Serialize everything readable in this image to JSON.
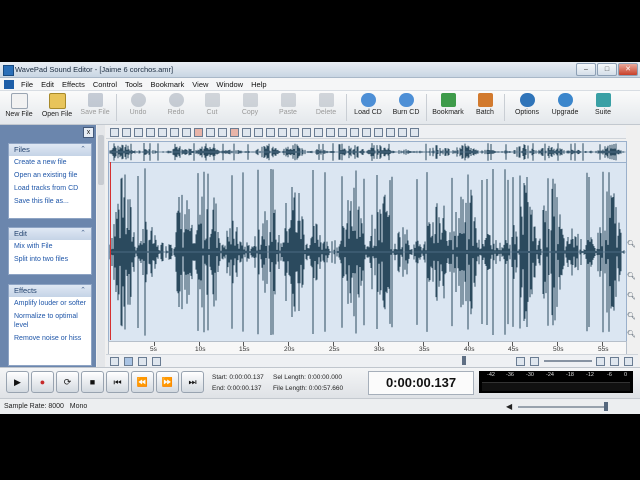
{
  "window": {
    "title": "WavePad Sound Editor - [Jaime 6 corchos.amr]"
  },
  "window_controls": {
    "minimize": "–",
    "maximize": "□",
    "close": "✕"
  },
  "mdi_controls": {
    "minimize": "–",
    "restore": "□",
    "close": "x"
  },
  "menu": [
    "File",
    "Edit",
    "Effects",
    "Control",
    "Tools",
    "Bookmark",
    "View",
    "Window",
    "Help"
  ],
  "toolbar": {
    "new_file": "New File",
    "open_file": "Open File",
    "save_file": "Save File",
    "undo": "Undo",
    "redo": "Redo",
    "cut": "Cut",
    "copy": "Copy",
    "paste": "Paste",
    "delete": "Delete",
    "load_cd": "Load CD",
    "burn_cd": "Burn CD",
    "bookmark": "Bookmark",
    "batch": "Batch",
    "options": "Options",
    "upgrade": "Upgrade",
    "suite": "Suite"
  },
  "sidebar": {
    "close": "x",
    "files": {
      "header": "Files",
      "items": [
        "Create a new file",
        "Open an existing file",
        "Load tracks from CD",
        "Save this file as..."
      ]
    },
    "edit": {
      "header": "Edit",
      "items": [
        "Mix with File",
        "Split into two files"
      ]
    },
    "effects": {
      "header": "Effects",
      "items": [
        "Amplify louder or softer",
        "Normalize to optimal level",
        "Remove noise or hiss"
      ]
    }
  },
  "timeline": {
    "ticks": [
      "5s",
      "10s",
      "15s",
      "20s",
      "25s",
      "30s",
      "35s",
      "40s",
      "45s",
      "50s",
      "55s"
    ]
  },
  "transport": {
    "start_label": "Start:",
    "start": "0:00:00.137",
    "end_label": "End:",
    "end": "0:00:00.137",
    "sel_length_label": "Sel Length:",
    "sel_length": "0:00:00.000",
    "file_length_label": "File Length:",
    "file_length": "0:00:57.660",
    "current_time": "0:00:00.137"
  },
  "meter": {
    "labels": [
      "-42",
      "-36",
      "-30",
      "-24",
      "-18",
      "-12",
      "-6",
      "0"
    ]
  },
  "status": {
    "sample_rate": "Sample Rate: 8000",
    "channels": "Mono"
  },
  "colors": {
    "waveform": "#2b4a5e",
    "waveform_bg": "#dbe6f2",
    "sidebar_bg": "#6b86ad",
    "cursor": "#d53030"
  }
}
